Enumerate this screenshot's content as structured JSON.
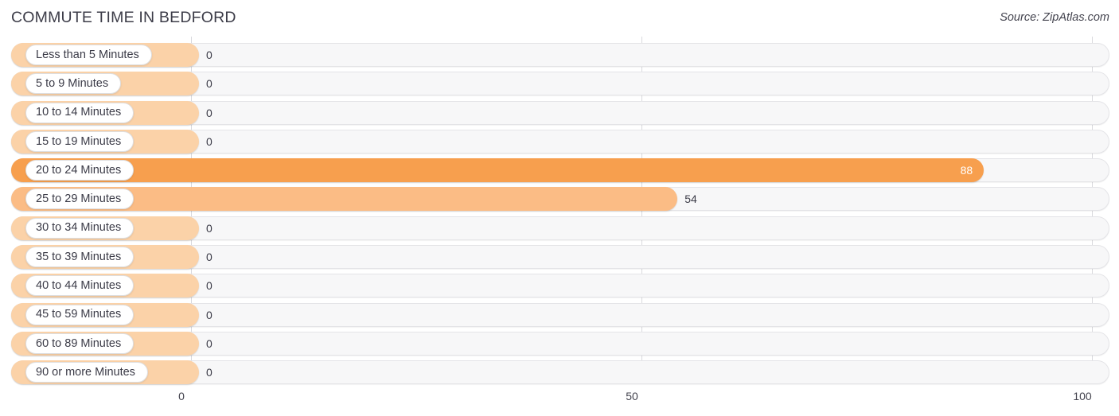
{
  "header": {
    "title": "COMMUTE TIME IN BEDFORD",
    "source": "Source: ZipAtlas.com"
  },
  "colors": {
    "bar_strong": "#f79f4e",
    "bar_light": "#fbbc85",
    "bar_zero": "#fbd2a8",
    "track": "#f7f7f8",
    "track_border": "#e4e4e7",
    "gridline": "#d9d9dd",
    "text": "#3b3b47",
    "value_in_bar": "#ffffff"
  },
  "chart_data": {
    "type": "bar",
    "orientation": "horizontal",
    "title": "COMMUTE TIME IN BEDFORD",
    "xlabel": "",
    "ylabel": "",
    "xlim": [
      0,
      100
    ],
    "xticks": [
      "0",
      "50",
      "100"
    ],
    "xtick_values": [
      0,
      50,
      100
    ],
    "grid": true,
    "legend": false,
    "categories": [
      "Less than 5 Minutes",
      "5 to 9 Minutes",
      "10 to 14 Minutes",
      "15 to 19 Minutes",
      "20 to 24 Minutes",
      "25 to 29 Minutes",
      "30 to 34 Minutes",
      "35 to 39 Minutes",
      "40 to 44 Minutes",
      "45 to 59 Minutes",
      "60 to 89 Minutes",
      "90 or more Minutes"
    ],
    "values": [
      0,
      0,
      0,
      0,
      88,
      54,
      0,
      0,
      0,
      0,
      0,
      0
    ],
    "value_labels": [
      "0",
      "0",
      "0",
      "0",
      "88",
      "54",
      "0",
      "0",
      "0",
      "0",
      "0",
      "0"
    ]
  }
}
